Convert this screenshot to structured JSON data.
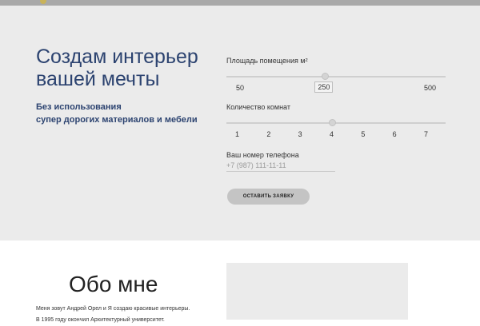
{
  "hero": {
    "headline": "Создам интерьер вашей мечты",
    "sub_line1": "Без использования",
    "sub_line2": "супер дорогих материалов и мебели"
  },
  "form": {
    "area": {
      "label": "Площадь помещения м²",
      "min_label": "50",
      "max_label": "500",
      "value_label": "250",
      "min": 50,
      "max": 500,
      "value": 250
    },
    "rooms": {
      "label": "Количество комнат",
      "options": [
        "1",
        "2",
        "3",
        "4",
        "5",
        "6",
        "7"
      ],
      "value": 4
    },
    "phone": {
      "label": "Ваш номер телефона",
      "placeholder": "+7 (987) 111-11-11"
    },
    "submit_label": "ОСТАВИТЬ ЗАЯВКУ"
  },
  "about": {
    "title": "Обо мне",
    "line1": "Меня зовут Андрей Орел и Я создаю красивые интерьеры.",
    "line2": "В 1995 году окончил Архитектурный университет."
  },
  "colors": {
    "accent": "#2c4370",
    "hero_bg": "#ebebeb",
    "topbar": "#a9a9a9",
    "button": "#c4c4c4"
  }
}
